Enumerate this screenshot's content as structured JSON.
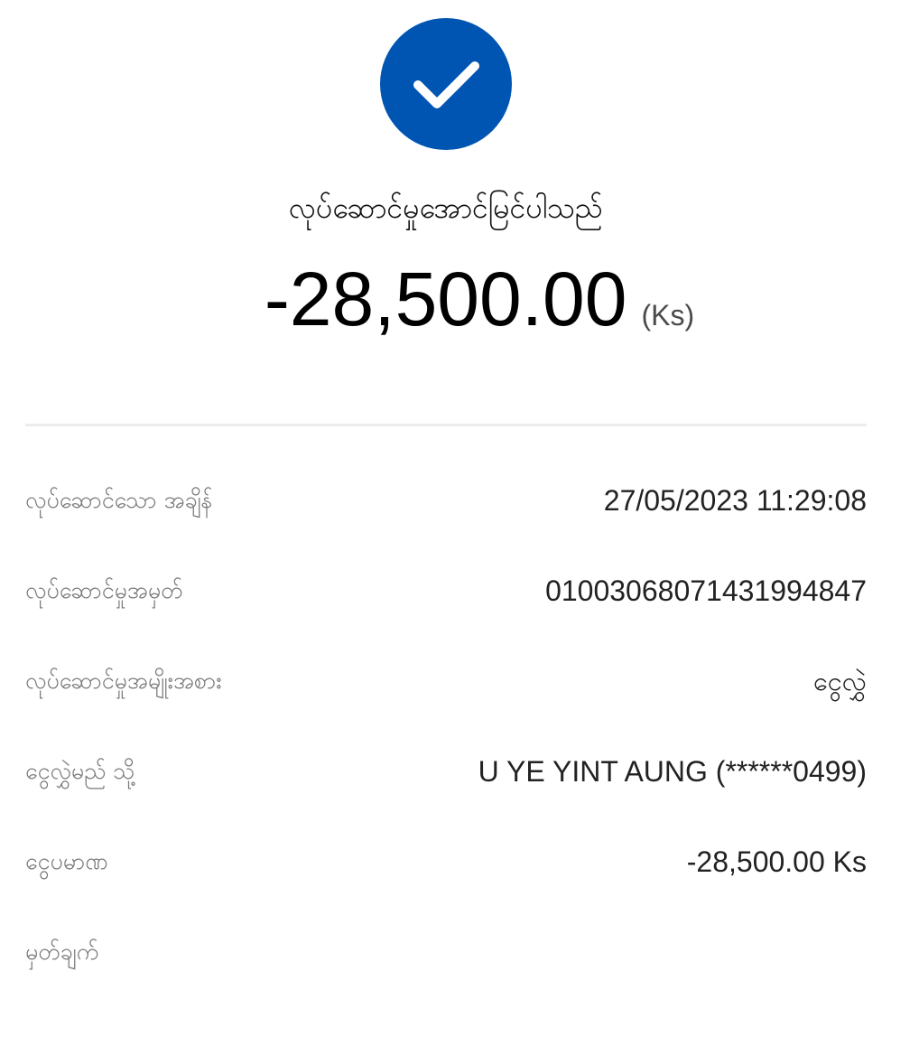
{
  "colors": {
    "accent": "#0055b2",
    "check": "#ffffff",
    "label": "#7a7a7a",
    "value": "#222222",
    "divider": "#ececec"
  },
  "status": {
    "icon": "checkmark-icon",
    "title": "လုပ်ဆောင်မှုအောင်မြင်ပါသည်"
  },
  "amount": {
    "value": "-28,500.00",
    "unit": "(Ks)"
  },
  "details": [
    {
      "label": "လုပ်ဆောင်သော အချိန်",
      "value": "27/05/2023 11:29:08"
    },
    {
      "label": "လုပ်ဆောင်မှုအမှတ်",
      "value": "01003068071431994847"
    },
    {
      "label": "လုပ်ဆောင်မှုအမျိုးအစား",
      "value": "ငွေလွှဲ"
    },
    {
      "label": "ငွေလွှဲမည် သို့",
      "value": "U YE YINT AUNG (******0499)"
    },
    {
      "label": "ငွေပမာဏ",
      "value": "-28,500.00 Ks"
    },
    {
      "label": "မှတ်ချက်",
      "value": ""
    }
  ]
}
